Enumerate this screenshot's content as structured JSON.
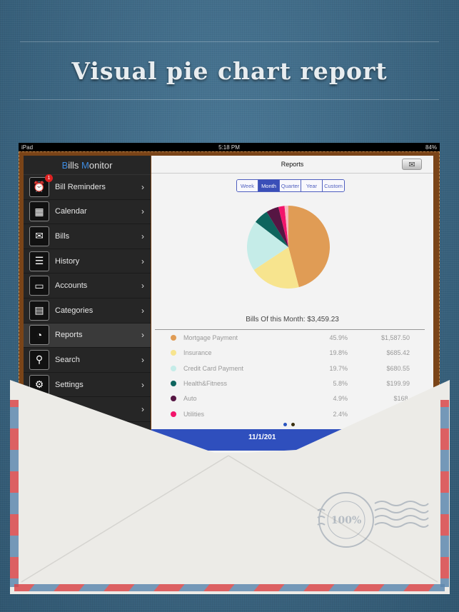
{
  "headline": "Visual pie chart report",
  "status_bar": {
    "device": "iPad",
    "time": "5:18 PM",
    "battery": "84%"
  },
  "sidebar": {
    "title_prefix_b": "B",
    "title_rest1": "ills ",
    "title_prefix_m": "M",
    "title_rest2": "onitor",
    "items": [
      {
        "label": "Bill Reminders",
        "icon": "alarm-clock-icon",
        "badge": "1"
      },
      {
        "label": "Calendar",
        "icon": "calendar-icon"
      },
      {
        "label": "Bills",
        "icon": "envelope-icon"
      },
      {
        "label": "History",
        "icon": "list-icon"
      },
      {
        "label": "Accounts",
        "icon": "card-icon"
      },
      {
        "label": "Categories",
        "icon": "cabinet-icon"
      },
      {
        "label": "Reports",
        "icon": "pie-icon",
        "active": true
      },
      {
        "label": "Search",
        "icon": "search-icon"
      },
      {
        "label": "Settings",
        "icon": "gear-icon"
      },
      {
        "label": "",
        "icon": ""
      }
    ]
  },
  "main": {
    "title": "Reports",
    "periods": [
      "Week",
      "Month",
      "Quarter",
      "Year",
      "Custom"
    ],
    "selected_period": "Month",
    "total_label": "Bills Of this Month: $3,459.23",
    "footer_date": "11/1/201"
  },
  "chart_data": {
    "type": "pie",
    "title": "",
    "slices": [
      {
        "name": "Mortgage Payment",
        "percent": 45.9,
        "amount": "$1,587.50",
        "pct_label": "45.9%",
        "color": "#e09c55"
      },
      {
        "name": "Insurance",
        "percent": 19.8,
        "amount": "$685.42",
        "pct_label": "19.8%",
        "color": "#f7e48e"
      },
      {
        "name": "Credit Card Payment",
        "percent": 19.7,
        "amount": "$680.55",
        "pct_label": "19.7%",
        "color": "#c5ece8"
      },
      {
        "name": "Health&Fitness",
        "percent": 5.8,
        "amount": "$199.99",
        "pct_label": "5.8%",
        "color": "#0e655e"
      },
      {
        "name": "Auto",
        "percent": 4.9,
        "amount": "$168.",
        "pct_label": "4.9%",
        "color": "#561643"
      },
      {
        "name": "Utilities",
        "percent": 2.4,
        "amount": "",
        "pct_label": "2.4%",
        "color": "#f2156b"
      },
      {
        "percent": 1.5,
        "color": "#f7b9bf"
      }
    ]
  },
  "page_dots": [
    "#2a55c0",
    "#3a3010"
  ],
  "stamp": {
    "text": "100%"
  }
}
